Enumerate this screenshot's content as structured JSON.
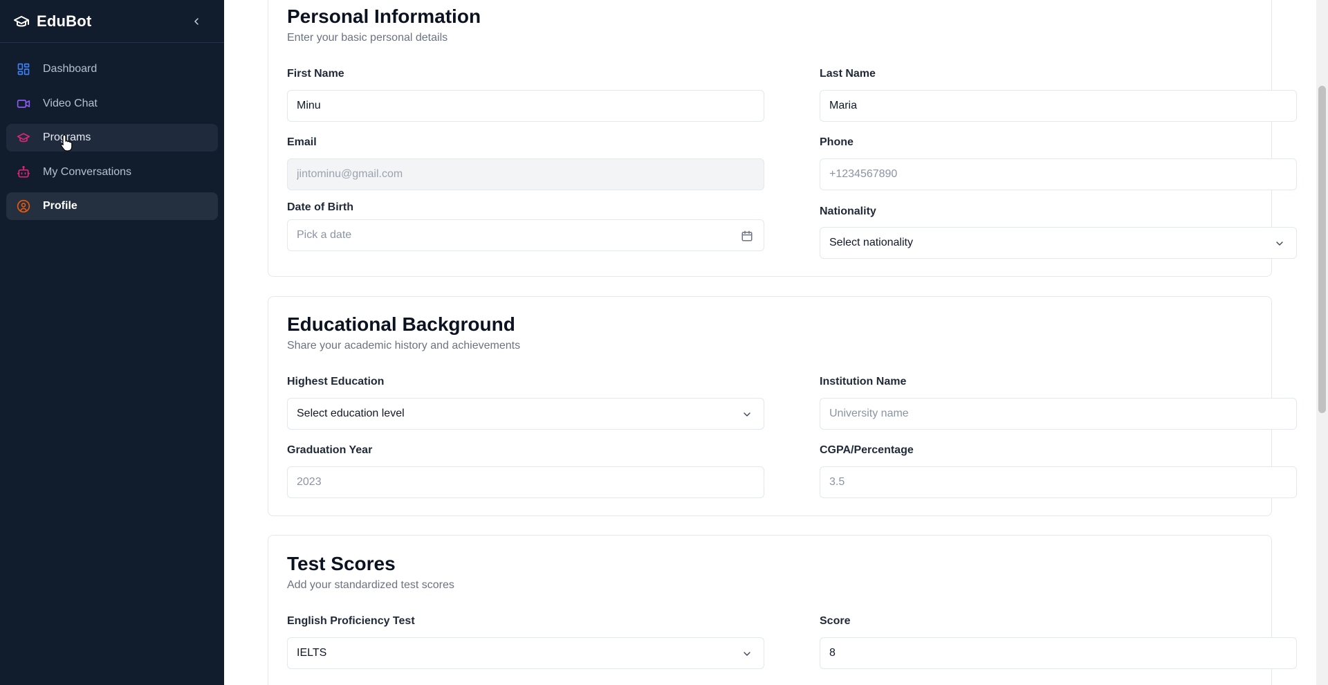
{
  "app": {
    "name": "EduBot"
  },
  "sidebar": {
    "items": [
      {
        "label": "Dashboard",
        "icon": "dashboard-icon",
        "color": "#3b82f6"
      },
      {
        "label": "Video Chat",
        "icon": "video-icon",
        "color": "#8b5cf6"
      },
      {
        "label": "Programs",
        "icon": "graduation-cap-icon",
        "color": "#db2777"
      },
      {
        "label": "My Conversations",
        "icon": "bot-icon",
        "color": "#db2777"
      },
      {
        "label": "Profile",
        "icon": "user-circle-icon",
        "color": "#ea580c"
      }
    ]
  },
  "personal": {
    "title": "Personal Information",
    "subtitle": "Enter your basic personal details",
    "first_name": {
      "label": "First Name",
      "value": "Minu"
    },
    "last_name": {
      "label": "Last Name",
      "value": "Maria"
    },
    "email": {
      "label": "Email",
      "value": "jintominu@gmail.com"
    },
    "phone": {
      "label": "Phone",
      "placeholder": "+1234567890"
    },
    "dob": {
      "label": "Date of Birth",
      "placeholder": "Pick a date"
    },
    "nationality": {
      "label": "Nationality",
      "value": "Select nationality"
    }
  },
  "education": {
    "title": "Educational Background",
    "subtitle": "Share your academic history and achievements",
    "highest": {
      "label": "Highest Education",
      "value": "Select education level"
    },
    "institution": {
      "label": "Institution Name",
      "placeholder": "University name"
    },
    "grad_year": {
      "label": "Graduation Year",
      "placeholder": "2023"
    },
    "cgpa": {
      "label": "CGPA/Percentage",
      "placeholder": "3.5"
    }
  },
  "tests": {
    "title": "Test Scores",
    "subtitle": "Add your standardized test scores",
    "english": {
      "label": "English Proficiency Test",
      "value": "IELTS"
    },
    "score": {
      "label": "Score",
      "value": "8"
    }
  }
}
